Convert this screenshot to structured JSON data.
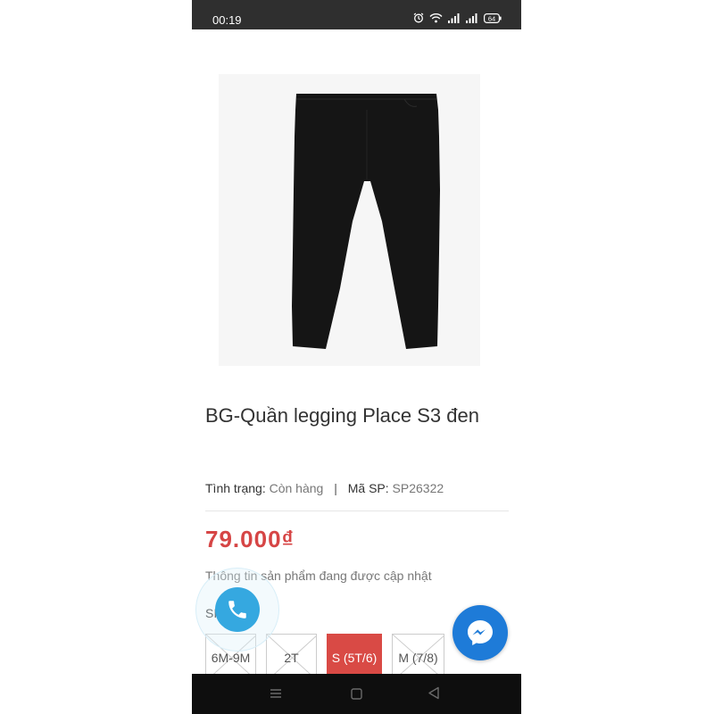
{
  "status_bar": {
    "time": "00:19",
    "battery": "64",
    "icons": [
      "alarm-icon",
      "wifi-icon",
      "signal-icon",
      "signal-icon",
      "battery-icon"
    ]
  },
  "product": {
    "image": "black-leggings-image",
    "title": "BG-Quần legging Place S3 đen",
    "status_label": "Tình trạng:",
    "status_value": "Còn hàng",
    "separator": "|",
    "sku_label": "Mã SP:",
    "sku_value": "SP26322",
    "price": "79.000₫",
    "description": "Thông tin sản phẩm đang được cập nhật",
    "size_label": "SIZE:",
    "sizes": [
      {
        "label": "6M-9M",
        "available": false,
        "selected": false
      },
      {
        "label": "2T",
        "available": false,
        "selected": false
      },
      {
        "label": "S (5T/6)",
        "available": true,
        "selected": true
      },
      {
        "label": "M (7/8)",
        "available": false,
        "selected": false
      }
    ]
  },
  "floating": {
    "call_icon": "phone-icon",
    "messenger_icon": "messenger-icon"
  },
  "nav_bar": {
    "icons": [
      "menu-icon",
      "home-icon",
      "back-icon"
    ]
  },
  "colors": {
    "price": "#d64545",
    "selected_size": "#d94a45",
    "call_button": "#35a8e0",
    "messenger_button": "#1e7bd8",
    "status_bar": "#2f2f2f",
    "nav_bar": "#0e0e0e"
  }
}
